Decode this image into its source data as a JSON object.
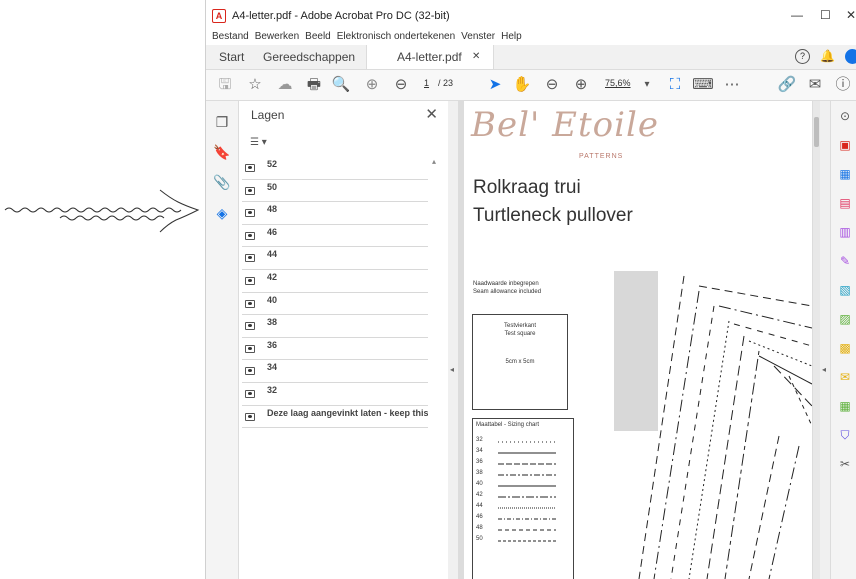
{
  "window": {
    "title": "A4-letter.pdf - Adobe Acrobat Pro DC (32-bit)"
  },
  "menu": [
    "Bestand",
    "Bewerken",
    "Beeld",
    "Elektronisch ondertekenen",
    "Venster",
    "Help"
  ],
  "tabs": {
    "start": "Start",
    "tools": "Gereedschappen",
    "doc": "A4-letter.pdf"
  },
  "toolbar": {
    "page_current": "1",
    "page_total": "/ 23",
    "zoom": "75,6%"
  },
  "layers_panel": {
    "title": "Lagen",
    "items": [
      "52",
      "50",
      "48",
      "46",
      "44",
      "42",
      "40",
      "38",
      "36",
      "34",
      "32",
      "Deze laag aangevinkt laten - keep this layer"
    ]
  },
  "page": {
    "brand": "Bel' Etoile",
    "brand_sub": "PATTERNS",
    "title_nl": "Rolkraag trui",
    "title_en": "Turtleneck pullover",
    "seam_nl": "Naadwaarde inbegrepen",
    "seam_en": "Seam allowance included",
    "test_nl": "Testvierkant",
    "test_en": "Test square",
    "test_size": "5cm x 5cm",
    "chart_title": "Maattabel - Sizing chart",
    "sizes": [
      "32",
      "34",
      "36",
      "38",
      "40",
      "42",
      "44",
      "46",
      "48",
      "50"
    ]
  },
  "colors": {
    "accent": "#1473e6",
    "brand": "#c9a89a"
  }
}
